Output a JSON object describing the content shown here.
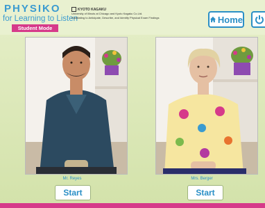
{
  "header": {
    "brand_title": "PHYSIKO",
    "brand_subtitle": "for Learning to Listen",
    "mode_badge": "Student Mode",
    "vendor_name": "KYOTO KAGAKU",
    "vendor_line1": "University of Illinois at Chicago and Kyoto Kagaku Co.Ltd.",
    "vendor_line2": "Facilitating to Anticipate, Describe, and Identify Physical Exam Findings",
    "home_label": "Home"
  },
  "patients": [
    {
      "name": "Mr. Reyes",
      "start_label": "Start"
    },
    {
      "name": "Mrs. Berger",
      "start_label": "Start"
    }
  ],
  "icons": {
    "home": "house-icon",
    "power": "power-icon",
    "vendor": "kyoto-kagaku-logo"
  },
  "colors": {
    "accent_blue": "#2a8fc6",
    "magenta": "#d63a8a",
    "background": "#d3e2aa"
  }
}
